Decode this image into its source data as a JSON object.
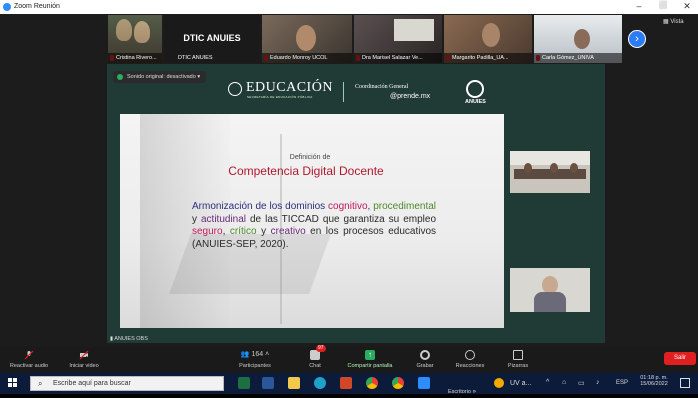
{
  "window": {
    "title": "Zoom Reunión",
    "minimize": "–",
    "restore": "⬜",
    "close": "✕"
  },
  "view_label": "Vista",
  "participants_strip": [
    {
      "name": "Cristina Rivero...",
      "color": "#8b6a52"
    },
    {
      "name": "DTIC ANUIES",
      "label": "DTIC ANUIES",
      "color": "#1a1a1a"
    },
    {
      "name": "Eduardo Monroy UCOL",
      "color": "#5a4638"
    },
    {
      "name": "Dra Marisel Salazar Ve...",
      "color": "#4a4040"
    },
    {
      "name": "Margarito Padilla_UA...",
      "color": "#6a5a48"
    },
    {
      "name": "Carla Gómez_UNIVA",
      "color": "#9aa0a6"
    }
  ],
  "next_participants_icon": "chevron-right-icon",
  "audio_notice": "Sonido original: desactivado",
  "share_header": {
    "logo_text": "EDUCACIÓN",
    "logo_sub": "SECRETARÍA DE EDUCACIÓN PÚBLICA",
    "coordination": "Coordinación General",
    "prende": "@prende.mx",
    "anuies": "ANUIES"
  },
  "slide": {
    "definition_label": "Definición de",
    "title": "Competencia Digital Docente",
    "body_parts": [
      {
        "text": "Armonización de los dominios ",
        "cls": "hl-blue"
      },
      {
        "text": "cognitivo",
        "cls": "hl-red"
      },
      {
        "text": ", ",
        "cls": "hl-blue"
      },
      {
        "text": "procedimental",
        "cls": "hl-green"
      },
      {
        "text": " y ",
        "cls": ""
      },
      {
        "text": "actitudinal",
        "cls": "hl-purple"
      },
      {
        "text": " de las TICCAD que garantiza su empleo ",
        "cls": ""
      },
      {
        "text": "seguro",
        "cls": "hl-red"
      },
      {
        "text": ", ",
        "cls": ""
      },
      {
        "text": "crítico",
        "cls": "hl-green"
      },
      {
        "text": " y ",
        "cls": ""
      },
      {
        "text": "creativo",
        "cls": "hl-purple"
      },
      {
        "text": " en los procesos educativos (ANUIES-SEP, 2020).",
        "cls": ""
      }
    ]
  },
  "share_label": "ANUIES OBS",
  "toolbar": {
    "audio": "Reactivar audio",
    "video": "Iniciar video",
    "participants": "Participantes",
    "participants_count": "164",
    "chat": "Chat",
    "chat_badge": "97",
    "share": "Compartir pantalla",
    "record": "Grabar",
    "reactions": "Reacciones",
    "whiteboards": "Pizarras",
    "leave": "Salir"
  },
  "taskbar": {
    "search_placeholder": "Escribe aquí para buscar",
    "desktop_label": "Escritorio",
    "uv_label": "UV a...",
    "lang": "ESP",
    "time": "01:18 p. m.",
    "date": "15/06/2022"
  },
  "colors": {
    "zoom_blue": "#2d8cff",
    "leave_red": "#e02020",
    "share_bg": "#203a35"
  }
}
